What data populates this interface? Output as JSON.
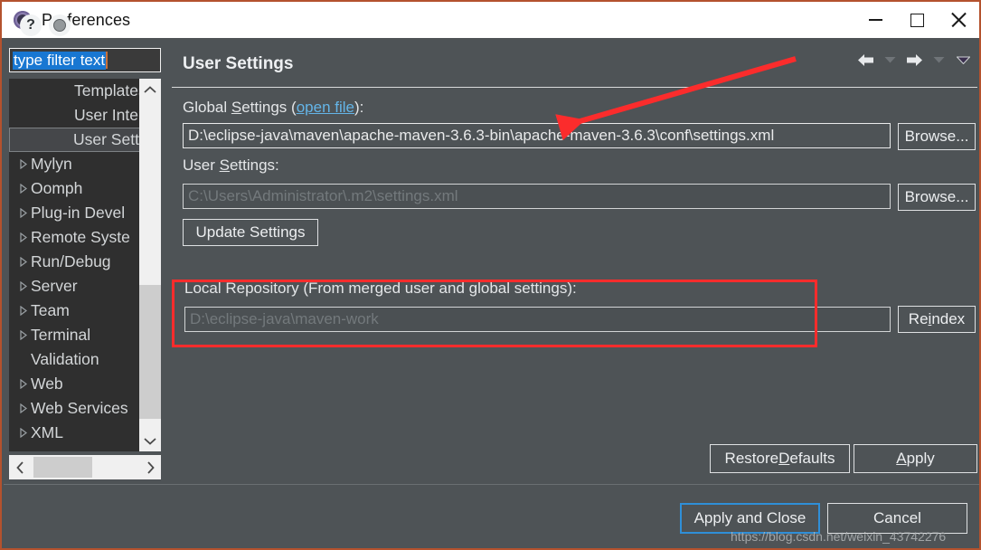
{
  "window": {
    "title": "Preferences",
    "icon": "preferences-gear-icon",
    "controls": {
      "minimize": "minimize-icon",
      "maximize": "maximize-icon",
      "close": "close-icon"
    }
  },
  "sidebar": {
    "filter": {
      "value": "type filter text",
      "placeholder": "type filter text"
    },
    "items": [
      {
        "label": "Templates",
        "indent": "child",
        "expandable": false,
        "selected": false
      },
      {
        "label": "User Interfa",
        "indent": "child",
        "expandable": false,
        "selected": false
      },
      {
        "label": "User Setting",
        "indent": "child",
        "expandable": false,
        "selected": true
      },
      {
        "label": "Mylyn",
        "indent": "root",
        "expandable": true,
        "selected": false
      },
      {
        "label": "Oomph",
        "indent": "root",
        "expandable": true,
        "selected": false
      },
      {
        "label": "Plug-in Devel",
        "indent": "root",
        "expandable": true,
        "selected": false
      },
      {
        "label": "Remote Syste",
        "indent": "root",
        "expandable": true,
        "selected": false
      },
      {
        "label": "Run/Debug",
        "indent": "root",
        "expandable": true,
        "selected": false
      },
      {
        "label": "Server",
        "indent": "root",
        "expandable": true,
        "selected": false
      },
      {
        "label": "Team",
        "indent": "root",
        "expandable": true,
        "selected": false
      },
      {
        "label": "Terminal",
        "indent": "root",
        "expandable": true,
        "selected": false
      },
      {
        "label": "Validation",
        "indent": "root",
        "expandable": false,
        "selected": false
      },
      {
        "label": "Web",
        "indent": "root",
        "expandable": true,
        "selected": false
      },
      {
        "label": "Web Services",
        "indent": "root",
        "expandable": true,
        "selected": false
      },
      {
        "label": "XML",
        "indent": "root",
        "expandable": true,
        "selected": false
      }
    ]
  },
  "panel": {
    "title": "User Settings",
    "nav": {
      "back": "back-arrow-icon",
      "back_menu": "chevron-down-icon",
      "forward": "forward-arrow-icon",
      "forward_menu": "chevron-down-icon",
      "view_menu": "view-menu-chevron-icon"
    },
    "global_settings": {
      "label_before": "Global ",
      "label_mnemonic": "S",
      "label_after": "ettings (",
      "link": "open file",
      "label_end": "):",
      "value": "D:\\eclipse-java\\maven\\apache-maven-3.6.3-bin\\apache-maven-3.6.3\\conf\\settings.xml",
      "browse_label": "Browse..."
    },
    "user_settings": {
      "label_before": "User ",
      "label_mnemonic": "S",
      "label_after": "ettings:",
      "value": "C:\\Users\\Administrator\\.m2\\settings.xml",
      "disabled": true,
      "browse_label": "Browse..."
    },
    "update_settings_label": "Update Settings",
    "local_repository": {
      "label": "Local Repository (From merged user and global settings):",
      "value": "D:\\eclipse-java\\maven-work",
      "reindex_before": "Re",
      "reindex_mnemonic": "i",
      "reindex_after": "ndex"
    },
    "restore_defaults": {
      "before": "Restore ",
      "mnemonic": "D",
      "after": "efaults"
    },
    "apply": {
      "before": "",
      "mnemonic": "A",
      "after": "pply"
    }
  },
  "bottom": {
    "help_icon": "help-question-icon",
    "settings_icon": "settings-circle-icon",
    "apply_and_close": "Apply and Close",
    "cancel": "Cancel"
  },
  "annotations": {
    "watermark": "https://blog.csdn.net/weixin_43742276",
    "arrow_color": "#fb2c2c",
    "highlight_color": "#fb2c2c"
  },
  "colors": {
    "panel_bg": "#4e5356",
    "tree_bg": "#2f2f2f",
    "titlebar_bg": "#ffffff",
    "window_border": "#b4522e",
    "link": "#64b5e8",
    "focus_blue": "#2f8fd8",
    "selection_blue": "#1877d2"
  }
}
